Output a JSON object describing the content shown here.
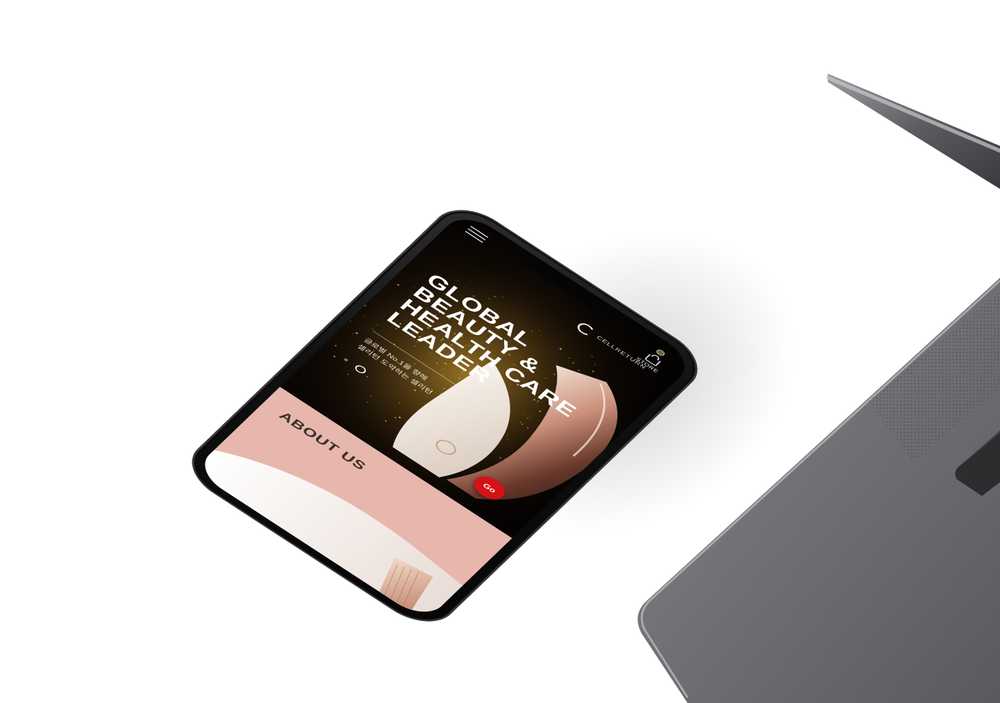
{
  "phone_screen": {
    "logo_text": "CELLRETURN",
    "store_label": "STORE",
    "hero": {
      "title_lines": [
        "GLOBAL",
        "BEAUTY &",
        "HEALTH CARE",
        "LEADER"
      ],
      "subtitle_lines": [
        "글로벌 No.1을 향해",
        "셀리턴 도약하는 셀리턴"
      ],
      "go_label": "Go",
      "slide_count": 2,
      "active_slide": 2
    },
    "about": {
      "title": "ABOUT US"
    }
  },
  "colors": {
    "background": "#ffffff",
    "accent_red": "#d41218",
    "about_pink": "#e7b7ad",
    "laptop_gray": "#6e6e70"
  },
  "icons": [
    "menu-icon",
    "logo-mark-icon",
    "language-flag-icon",
    "store-bag-icon"
  ]
}
